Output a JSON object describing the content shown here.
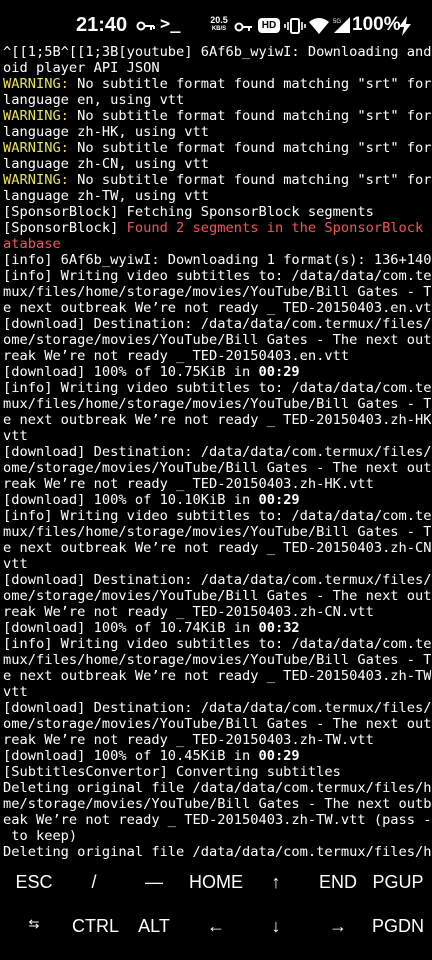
{
  "status_bar": {
    "time": "21:40",
    "prompt_icon": "terminal-prompt-icon",
    "net_speed": "20.5",
    "net_speed_unit": "KB/S",
    "hd": "HD",
    "battery": "100%"
  },
  "terminal": {
    "lines": [
      [
        {
          "t": "^[[1;5B^[[1;3B[youtube] 6Af6b_wyiwI: Downloading andr"
        }
      ],
      [
        {
          "t": "oid player API JSON"
        }
      ],
      [
        {
          "t": "WARNING:",
          "c": "warn"
        },
        {
          "t": " No subtitle format found matching \"srt\" for"
        }
      ],
      [
        {
          "t": "language en, using vtt"
        }
      ],
      [
        {
          "t": "WARNING:",
          "c": "warn"
        },
        {
          "t": " No subtitle format found matching \"srt\" for"
        }
      ],
      [
        {
          "t": "language zh-HK, using vtt"
        }
      ],
      [
        {
          "t": "WARNING:",
          "c": "warn"
        },
        {
          "t": " No subtitle format found matching \"srt\" for"
        }
      ],
      [
        {
          "t": "language zh-CN, using vtt"
        }
      ],
      [
        {
          "t": "WARNING:",
          "c": "warn"
        },
        {
          "t": " No subtitle format found matching \"srt\" for"
        }
      ],
      [
        {
          "t": "language zh-TW, using vtt"
        }
      ],
      [
        {
          "t": "[SponsorBlock] Fetching SponsorBlock segments"
        }
      ],
      [
        {
          "t": "[SponsorBlock] "
        },
        {
          "t": "Found 2 segments in the SponsorBlock d",
          "c": "red"
        }
      ],
      [
        {
          "t": "atabase",
          "c": "red"
        }
      ],
      [
        {
          "t": "[info] 6Af6b_wyiwI: Downloading 1 format(s): 136+140"
        }
      ],
      [
        {
          "t": "[info] Writing video subtitles to: /data/data/com.ter"
        }
      ],
      [
        {
          "t": "mux/files/home/storage/movies/YouTube/Bill Gates - Th"
        }
      ],
      [
        {
          "t": "e next outbreak We’re not ready _ TED-20150403.en.vtt"
        }
      ],
      [
        {
          "t": "[download] Destination: /data/data/com.termux/files/h"
        }
      ],
      [
        {
          "t": "ome/storage/movies/YouTube/Bill Gates - The next outb"
        }
      ],
      [
        {
          "t": "reak We’re not ready _ TED-20150403.en.vtt"
        }
      ],
      [
        {
          "t": "[download] 100% of 10.75KiB in "
        },
        {
          "t": "00:29",
          "c": "b"
        }
      ],
      [
        {
          "t": "[info] Writing video subtitles to: /data/data/com.ter"
        }
      ],
      [
        {
          "t": "mux/files/home/storage/movies/YouTube/Bill Gates - Th"
        }
      ],
      [
        {
          "t": "e next outbreak We’re not ready _ TED-20150403.zh-HK."
        }
      ],
      [
        {
          "t": "vtt"
        }
      ],
      [
        {
          "t": "[download] Destination: /data/data/com.termux/files/h"
        }
      ],
      [
        {
          "t": "ome/storage/movies/YouTube/Bill Gates - The next outb"
        }
      ],
      [
        {
          "t": "reak We’re not ready _ TED-20150403.zh-HK.vtt"
        }
      ],
      [
        {
          "t": "[download] 100% of 10.10KiB in "
        },
        {
          "t": "00:29",
          "c": "b"
        }
      ],
      [
        {
          "t": "[info] Writing video subtitles to: /data/data/com.ter"
        }
      ],
      [
        {
          "t": "mux/files/home/storage/movies/YouTube/Bill Gates - Th"
        }
      ],
      [
        {
          "t": "e next outbreak We’re not ready _ TED-20150403.zh-CN."
        }
      ],
      [
        {
          "t": "vtt"
        }
      ],
      [
        {
          "t": "[download] Destination: /data/data/com.termux/files/h"
        }
      ],
      [
        {
          "t": "ome/storage/movies/YouTube/Bill Gates - The next outb"
        }
      ],
      [
        {
          "t": "reak We’re not ready _ TED-20150403.zh-CN.vtt"
        }
      ],
      [
        {
          "t": "[download] 100% of 10.74KiB in "
        },
        {
          "t": "00:32",
          "c": "b"
        }
      ],
      [
        {
          "t": "[info] Writing video subtitles to: /data/data/com.ter"
        }
      ],
      [
        {
          "t": "mux/files/home/storage/movies/YouTube/Bill Gates - Th"
        }
      ],
      [
        {
          "t": "e next outbreak We’re not ready _ TED-20150403.zh-TW."
        }
      ],
      [
        {
          "t": "vtt"
        }
      ],
      [
        {
          "t": "[download] Destination: /data/data/com.termux/files/h"
        }
      ],
      [
        {
          "t": "ome/storage/movies/YouTube/Bill Gates - The next outb"
        }
      ],
      [
        {
          "t": "reak We’re not ready _ TED-20150403.zh-TW.vtt"
        }
      ],
      [
        {
          "t": "[download] 100% of 10.45KiB in "
        },
        {
          "t": "00:29",
          "c": "b"
        }
      ],
      [
        {
          "t": "[SubtitlesConvertor] Converting subtitles"
        }
      ],
      [
        {
          "t": "Deleting original file /data/data/com.termux/files/ho"
        }
      ],
      [
        {
          "t": "me/storage/movies/YouTube/Bill Gates - The next outbr"
        }
      ],
      [
        {
          "t": "eak We’re not ready _ TED-20150403.zh-TW.vtt (pass -k"
        }
      ],
      [
        {
          "t": " to keep)"
        }
      ],
      [
        {
          "t": "Deleting original file /data/data/com.termux/files/ho"
        }
      ]
    ]
  },
  "extra_keys": {
    "row1": [
      "ESC",
      "/",
      "—",
      "HOME",
      "↑",
      "END",
      "PGUP"
    ],
    "row2": [
      "⇆",
      "CTRL",
      "ALT",
      "←",
      "↓",
      "→",
      "PGDN"
    ]
  },
  "colors": {
    "background": "#000000",
    "warning": "#e8e05a",
    "error": "#f0555a",
    "text": "#ffffff"
  }
}
